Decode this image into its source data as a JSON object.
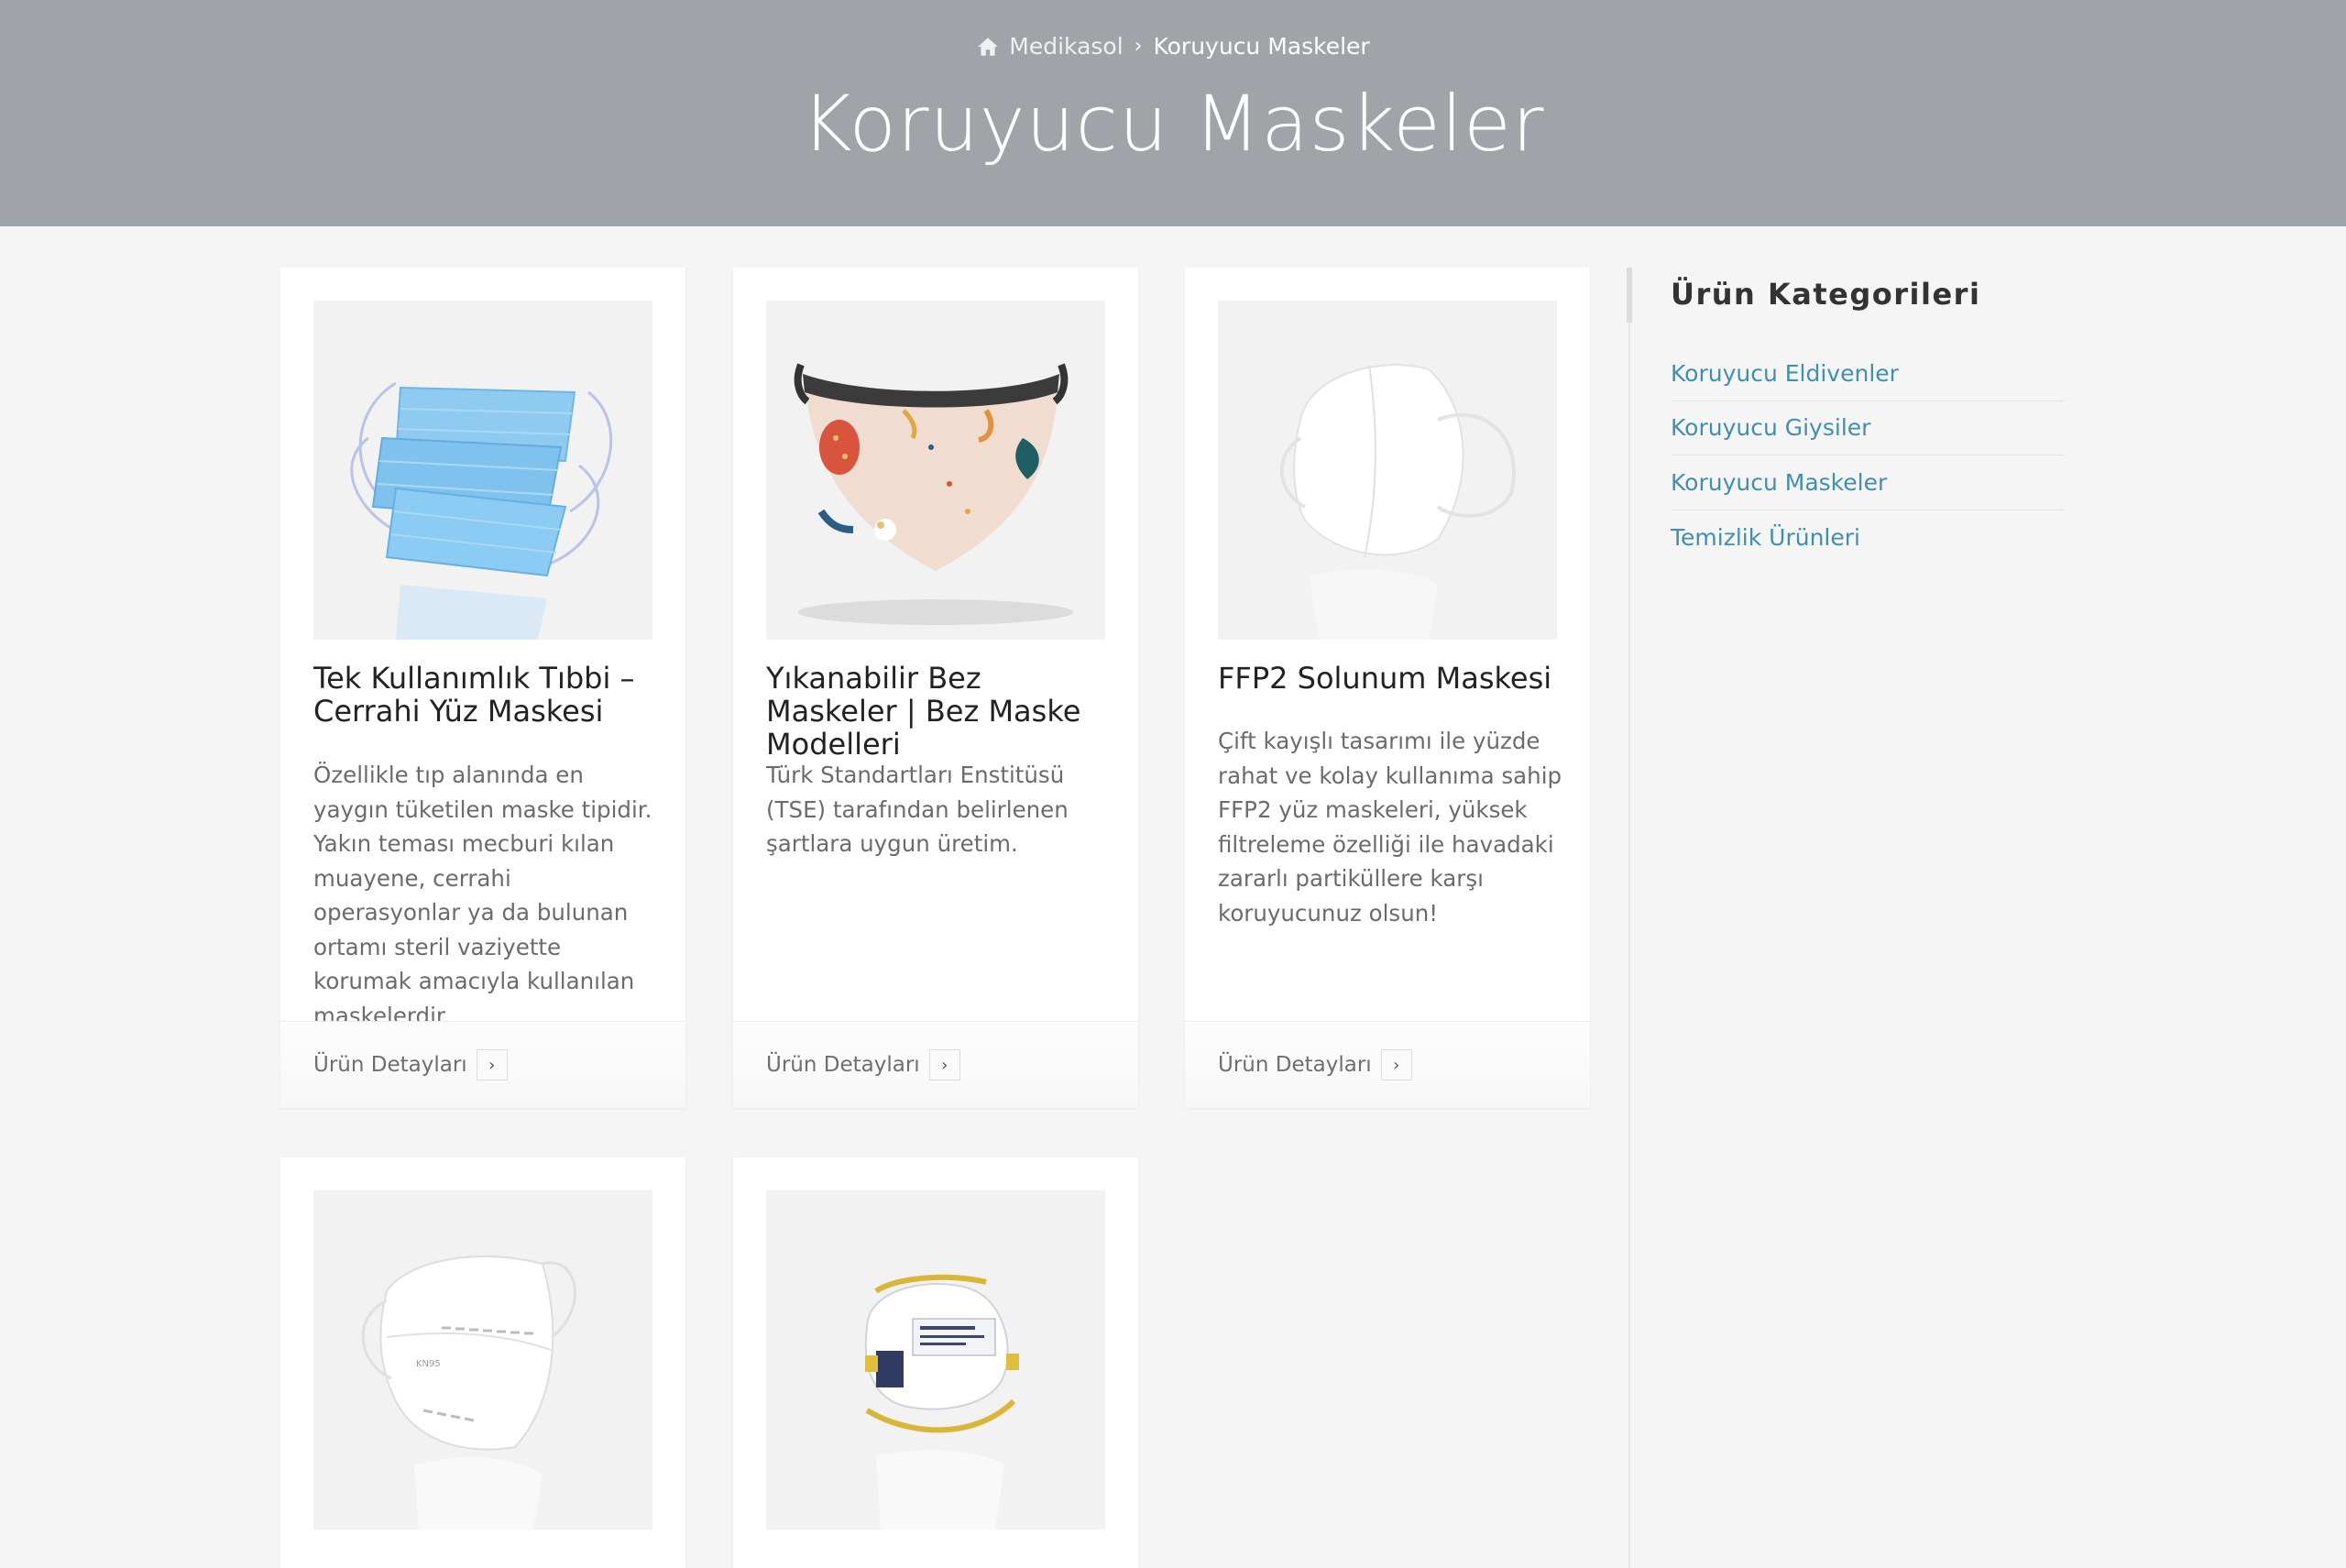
{
  "breadcrumb": {
    "home": "Medikasol",
    "separator": "›",
    "current": "Koruyucu Maskeler"
  },
  "page": {
    "title": "Koruyucu Maskeler"
  },
  "products": [
    {
      "title": "Tek Kullanımlık Tıbbi – Cerrahi Yüz Maskesi",
      "description": "Özellikle tıp alanında en yaygın tüketilen maske tipidir. Yakın teması mecburi kılan muayene, cerrahi operasyonlar ya da bulunan ortamı steril vaziyette korumak amacıyla kullanılan maskelerdir.",
      "details_label": "Ürün Detayları",
      "image_icon": "surgical-mask"
    },
    {
      "title": "Yıkanabilir Bez Maskeler | Bez Maske Modelleri",
      "description": "Türk Standartları Enstitüsü (TSE) tarafından belirlenen şartlara uygun üretim.",
      "details_label": "Ürün Detayları",
      "image_icon": "cloth-mask"
    },
    {
      "title": "FFP2 Solunum Maskesi",
      "description": "Çift kayışlı tasarımı ile yüzde rahat ve kolay kullanıma sahip FFP2 yüz maskeleri, yüksek filtreleme özelliği ile havadaki zararlı partiküllere karşı koruyucunuz olsun!",
      "details_label": "Ürün Detayları",
      "image_icon": "ffp2-mask"
    },
    {
      "image_icon": "kn95-mask",
      "image_text": "KN95"
    },
    {
      "image_icon": "n95-mask"
    }
  ],
  "sidebar": {
    "title": "Ürün Kategorileri",
    "items": [
      "Koruyucu Eldivenler",
      "Koruyucu Giysiler",
      "Koruyucu Maskeler",
      "Temizlik Ürünleri"
    ]
  },
  "colors": {
    "banner": "#a0a4a8",
    "link": "#3f8fb0",
    "background": "#f5f5f5"
  }
}
